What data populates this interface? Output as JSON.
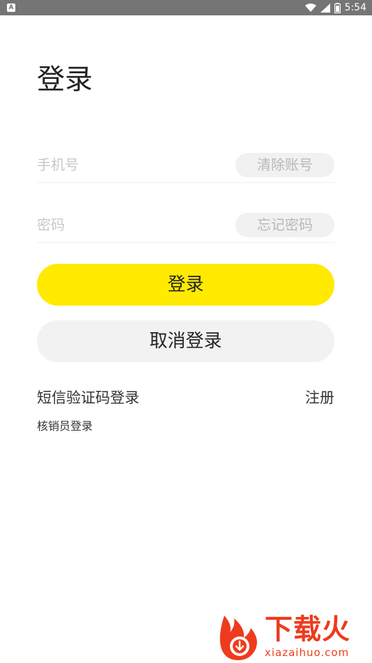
{
  "status_bar": {
    "left_icon": "A",
    "time": "5:54",
    "icons": [
      "wifi-icon",
      "signal-icon",
      "battery-icon"
    ]
  },
  "page": {
    "title": "登录"
  },
  "form": {
    "phone": {
      "placeholder": "手机号",
      "value": "",
      "clear_label": "清除账号"
    },
    "password": {
      "placeholder": "密码",
      "value": "",
      "forgot_label": "忘记密码"
    },
    "login_label": "登录",
    "cancel_label": "取消登录"
  },
  "links": {
    "sms_login": "短信验证码登录",
    "register": "注册",
    "verifier_login": "核销员登录"
  },
  "watermark": {
    "text": "下载火",
    "sub": "xiazaihuo.com"
  },
  "colors": {
    "primary": "#ffea00",
    "status_bar": "#757575",
    "watermark": "#ee3b1d"
  }
}
